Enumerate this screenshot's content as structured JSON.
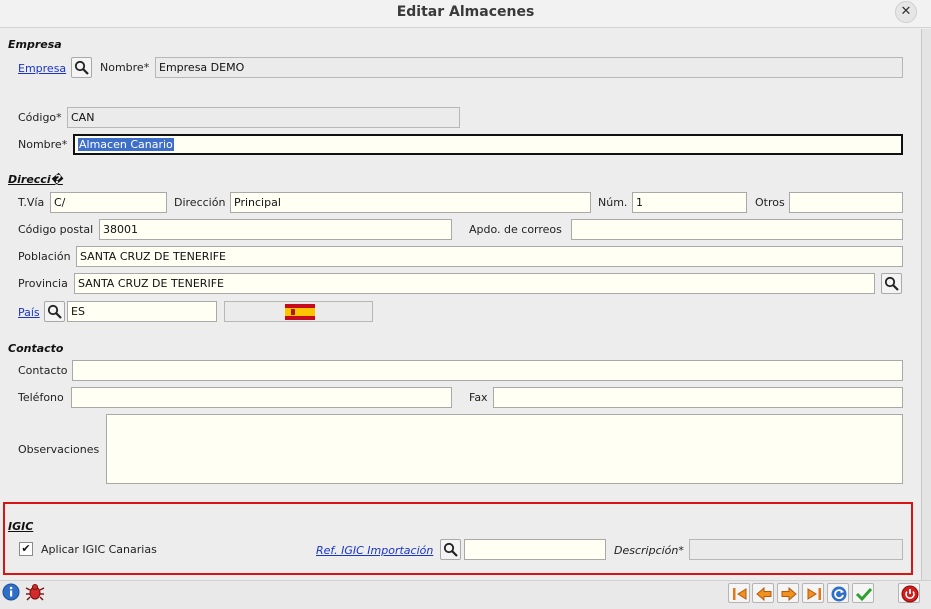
{
  "window": {
    "title": "Editar Almacenes",
    "close_glyph": "✕"
  },
  "empresa": {
    "section": "Empresa",
    "link": "Empresa",
    "nombre_label": "Nombre*",
    "nombre_value": "Empresa DEMO"
  },
  "almacen": {
    "codigo_label": "Código*",
    "codigo_value": "CAN",
    "nombre_label": "Nombre*",
    "nombre_value": "Almacen Canario"
  },
  "direccion": {
    "section": "Direcci�",
    "tvia_label": "T.Vía",
    "tvia_value": "C/",
    "direccion_label": "Dirección",
    "direccion_value": "Principal",
    "num_label": "Núm.",
    "num_value": "1",
    "otros_label": "Otros",
    "otros_value": "",
    "cp_label": "Código postal",
    "cp_value": "38001",
    "apdo_label": "Apdo. de correos",
    "apdo_value": "",
    "poblacion_label": "Población",
    "poblacion_value": "SANTA CRUZ DE TENERIFE",
    "provincia_label": "Provincia",
    "provincia_value": "SANTA CRUZ DE TENERIFE",
    "pais_link": "País",
    "pais_value": "ES",
    "flag_icon": "spain-flag-icon"
  },
  "contacto": {
    "section": "Contacto",
    "contacto_label": "Contacto",
    "contacto_value": "",
    "telefono_label": "Teléfono",
    "telefono_value": "",
    "fax_label": "Fax",
    "fax_value": "",
    "observaciones_label": "Observaciones",
    "observaciones_value": ""
  },
  "igic": {
    "section": "IGIC",
    "aplicar_label": "Aplicar IGIC Canarias",
    "aplicar_checked": true,
    "check_glyph": "✔",
    "ref_link": "Ref. IGIC Importación",
    "ref_value": "",
    "descripcion_label": "Descripción*",
    "descripcion_value": ""
  },
  "colors": {
    "highlight": "#d81414",
    "link": "#1a35c8",
    "field_bg": "#fffff4",
    "selection": "#3d6fc8"
  },
  "toolbar": {
    "left": [
      "info-icon",
      "bug-icon"
    ],
    "right": [
      "first-record-icon",
      "previous-record-icon",
      "next-record-icon",
      "last-record-icon",
      "refresh-icon",
      "accept-icon",
      "close-power-icon"
    ]
  }
}
